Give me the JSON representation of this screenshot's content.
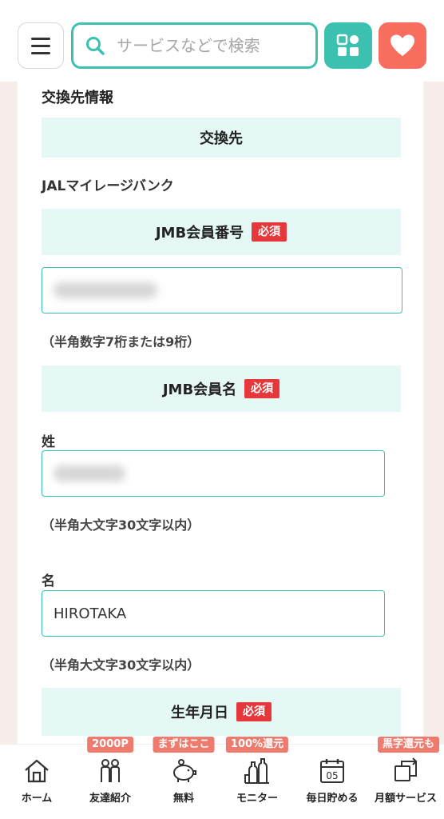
{
  "header": {
    "search_placeholder": "サービスなどで検索"
  },
  "form": {
    "section_title": "交換先情報",
    "exchange_band_label": "交換先",
    "exchange_value": "JALマイレージバンク",
    "required_label": "必須",
    "member_number": {
      "label": "JMB会員番号",
      "value": "",
      "note": "（半角数字7桁または9桁）"
    },
    "member_name": {
      "label": "JMB会員名",
      "last_name_label": "姓",
      "last_name_value": "",
      "last_name_note": "（半角大文字30文字以内）",
      "first_name_label": "名",
      "first_name_value": "HIROTAKA",
      "first_name_note": "（半角大文字30文字以内）"
    },
    "birthdate_label": "生年月日"
  },
  "bottom_nav": {
    "items": [
      {
        "label": "ホーム",
        "badge": "",
        "icon": "home-icon"
      },
      {
        "label": "友達紹介",
        "badge": "2000P",
        "icon": "friends-icon"
      },
      {
        "label": "無料",
        "badge": "まずはここ",
        "icon": "piggy-bank-icon"
      },
      {
        "label": "モニター",
        "badge": "100%還元",
        "icon": "bottles-icon"
      },
      {
        "label": "毎日貯める",
        "badge": "",
        "icon": "calendar-icon"
      },
      {
        "label": "月額サービス",
        "badge": "黒字還元も",
        "icon": "subscription-icon"
      }
    ],
    "calendar_day": "05"
  },
  "colors": {
    "accent": "#3cc1b1",
    "heart": "#f76d5e",
    "required": "#e6383a",
    "band": "#e6f8f5",
    "badge": "#ee7b6e"
  }
}
